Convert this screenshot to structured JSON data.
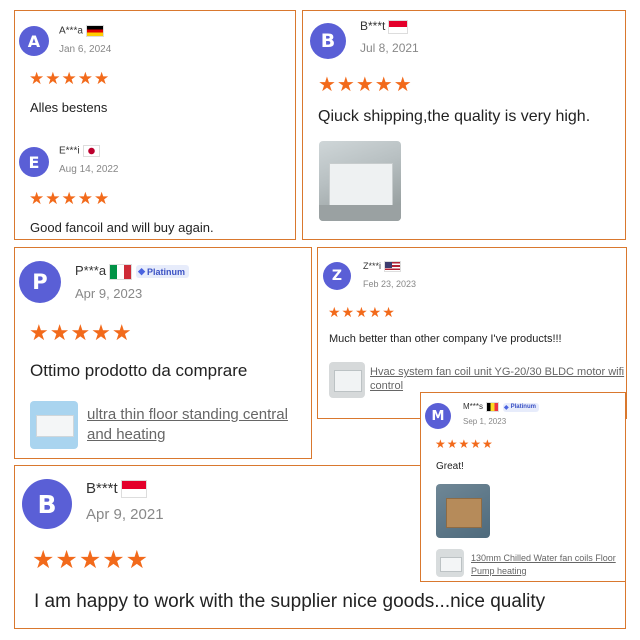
{
  "reviews": [
    {
      "avatar": "A",
      "name": "A***a",
      "date": "Jan 6, 2024",
      "flag": "germany-flag",
      "stars": "★★★★★",
      "text": "Alles bestens"
    },
    {
      "avatar": "E",
      "name": "E***i",
      "date": "Aug 14, 2022",
      "flag": "japan-flag",
      "stars": "★★★★★",
      "text": "Good fancoil and will buy again."
    },
    {
      "avatar": "B",
      "name": "B***t",
      "date": "Jul 8, 2021",
      "flag": "singapore-flag",
      "stars": "★★★★★",
      "text": "Qiuck shipping,the quality is very high."
    },
    {
      "avatar": "P",
      "name": "P***a",
      "date": "Apr 9, 2023",
      "flag": "italy-flag",
      "badge": "Platinum",
      "stars": "★★★★★",
      "text": "Ottimo prodotto da comprare",
      "product": "ultra thin floor standing central and heating"
    },
    {
      "avatar": "Z",
      "name": "Z***i",
      "date": "Feb 23, 2023",
      "flag": "usa-flag",
      "stars": "★★★★★",
      "text": "Much better than other company I've products!!!",
      "product": "Hvac system fan coil unit YG-20/30 BLDC motor wifi control"
    },
    {
      "avatar": "M",
      "name": "M***s",
      "date": "Sep 1, 2023",
      "flag": "belgium-flag",
      "badge": "Platinum",
      "stars": "★★★★★",
      "text": "Great!",
      "product": "130mm Chilled Water fan coils Floor Pump heating"
    },
    {
      "avatar": "B",
      "name": "B***t",
      "date": "Apr 9, 2021",
      "flag": "singapore-flag",
      "stars": "★★★★★",
      "text": "I am happy to work with the supplier nice goods...nice quality"
    }
  ],
  "colors": {
    "accent": "#d9782e",
    "star": "#f26a1b",
    "avatar": "#5a5fd6"
  }
}
